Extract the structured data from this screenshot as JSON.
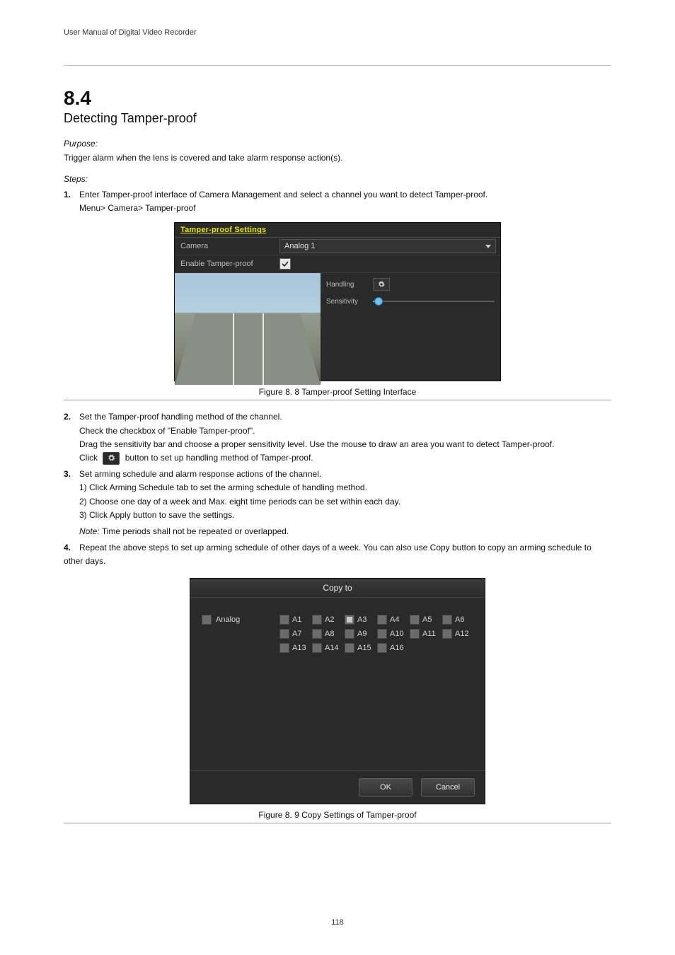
{
  "doc": {
    "manual_title": "User Manual of Digital Video Recorder"
  },
  "section": {
    "number": "8.4",
    "title": "Detecting Tamper-proof"
  },
  "purpose": {
    "label": "Purpose:",
    "text": "Trigger alarm when the lens is covered and take alarm response action(s)."
  },
  "steps_label": "Steps:",
  "steps": {
    "s1": {
      "n": "1.",
      "text": "Enter Tamper-proof interface of Camera Management and select a channel you want to detect Tamper-proof.",
      "sub": "Menu> Camera> Tamper-proof"
    },
    "s2": {
      "n": "2.",
      "text": "Set the Tamper-proof handling method of the channel.",
      "subs": [
        "Check the checkbox of \"Enable Tamper-proof\".",
        "Drag the sensitivity bar and choose a proper sensitivity level. Use the mouse to draw an area you want to detect Tamper-proof.",
        "Click         button to set up handling method of Tamper-proof."
      ]
    },
    "s3": {
      "n": "3.",
      "text": "Set arming schedule and alarm response actions of the channel.",
      "subs": [
        "Click Arming Schedule tab to set the arming schedule of handling method.",
        "Choose one day of a week and Max. eight time periods can be set within each day.",
        "Click Apply button to save the settings."
      ]
    },
    "s3_note": {
      "label": "Note:",
      "text": "Time periods shall not be repeated or overlapped."
    },
    "s4": {
      "n": "4.",
      "text": "Repeat the above steps to set up arming schedule of other days of a week. You can also use Copy button to copy an arming schedule to other days."
    }
  },
  "fig8_8": {
    "caption": "Figure 8. 8 Tamper-proof Setting Interface",
    "title": "Tamper-proof Settings",
    "camera_label": "Camera",
    "camera_value": "Analog 1",
    "enable_label": "Enable Tamper-proof",
    "handling_label": "Handling",
    "sensitivity_label": "Sensitivity"
  },
  "fig8_9": {
    "caption": "Figure 8. 9 Copy Settings of Tamper-proof",
    "title": "Copy to",
    "analog_label": "Analog",
    "items": [
      "A1",
      "A2",
      "A3",
      "A4",
      "A5",
      "A6",
      "A7",
      "A8",
      "A9",
      "A10",
      "A11",
      "A12",
      "A13",
      "A14",
      "A15",
      "A16"
    ],
    "checked_index": 2,
    "ok_label": "OK",
    "cancel_label": "Cancel"
  },
  "page_number": "118"
}
